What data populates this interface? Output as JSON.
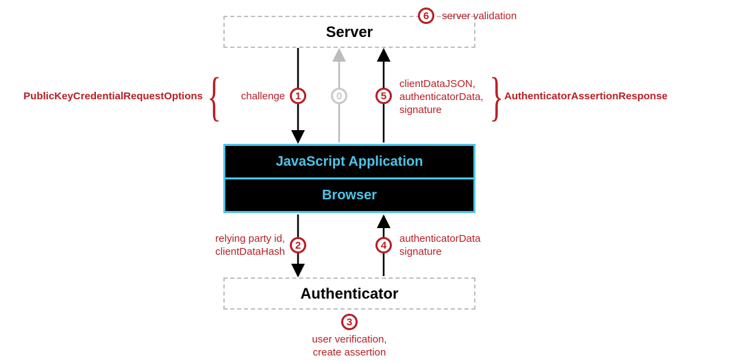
{
  "boxes": {
    "server": "Server",
    "jsApp": "JavaScript Application",
    "browser": "Browser",
    "authenticator": "Authenticator"
  },
  "steps": {
    "n0": "0",
    "n1": "1",
    "n2": "2",
    "n3": "3",
    "n4": "4",
    "n5": "5",
    "n6": "6"
  },
  "labels": {
    "leftBrace": "PublicKeyCredentialRequestOptions",
    "rightBrace": "AuthenticatorAssertionResponse",
    "step1": "challenge",
    "step2a": "relying party id,",
    "step2b": "clientDataHash",
    "step3a": "user verification,",
    "step3b": "create assertion",
    "step4a": "authenticatorData",
    "step4b": "signature",
    "step5a": "clientDataJSON,",
    "step5b": "authenticatorData,",
    "step5c": "signature",
    "step6": "server validation"
  }
}
